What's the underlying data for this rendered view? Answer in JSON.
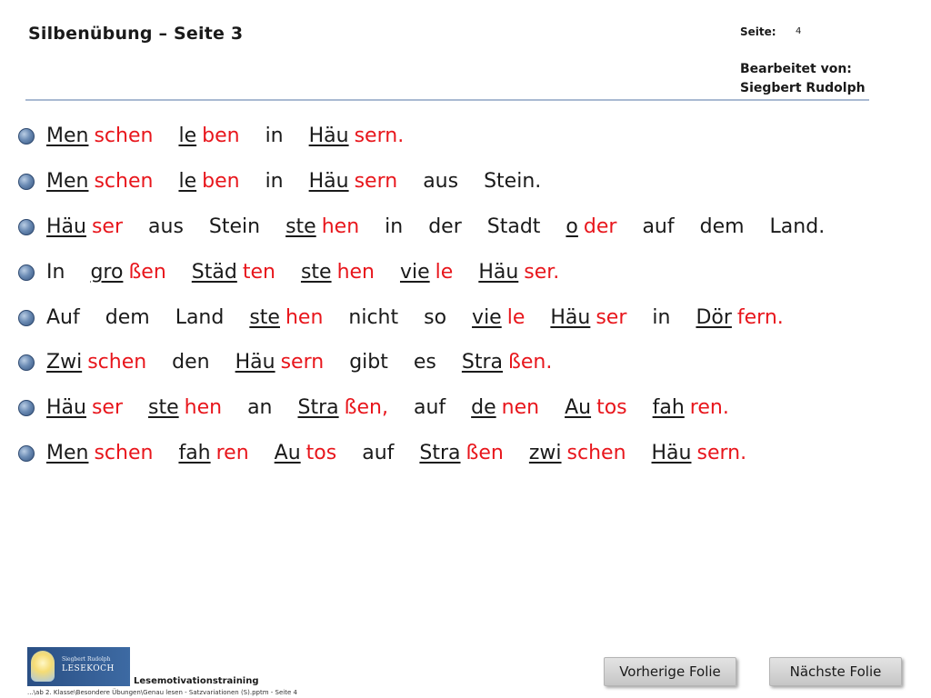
{
  "header": {
    "title": "Silbenübung – Seite 3",
    "page_label": "Seite:",
    "page_number": "4",
    "editor_label": "Bearbeitet von:",
    "editor_name": "Siegbert Rudolph"
  },
  "colors": {
    "accent_red": "#e8161c",
    "text": "#1a1a1a",
    "rule": "#a9bad2",
    "bullet": "#4a6a96"
  },
  "sentences": [
    {
      "words": [
        [
          {
            "t": "Men",
            "c": "black",
            "u": true
          },
          {
            "t": "schen",
            "c": "red",
            "u": false
          }
        ],
        [
          {
            "t": "le",
            "c": "black",
            "u": true
          },
          {
            "t": "ben",
            "c": "red",
            "u": false
          }
        ],
        [
          {
            "t": "in",
            "c": "black",
            "u": false
          }
        ],
        [
          {
            "t": "Häu",
            "c": "black",
            "u": true
          },
          {
            "t": "sern.",
            "c": "red",
            "u": false
          }
        ]
      ]
    },
    {
      "words": [
        [
          {
            "t": "Men",
            "c": "black",
            "u": true
          },
          {
            "t": "schen",
            "c": "red",
            "u": false
          }
        ],
        [
          {
            "t": "le",
            "c": "black",
            "u": true
          },
          {
            "t": "ben",
            "c": "red",
            "u": false
          }
        ],
        [
          {
            "t": "in",
            "c": "black",
            "u": false
          }
        ],
        [
          {
            "t": "Häu",
            "c": "black",
            "u": true
          },
          {
            "t": "sern",
            "c": "red",
            "u": false
          }
        ],
        [
          {
            "t": "aus",
            "c": "black",
            "u": false
          }
        ],
        [
          {
            "t": "Stein.",
            "c": "black",
            "u": false
          }
        ]
      ]
    },
    {
      "words": [
        [
          {
            "t": "Häu",
            "c": "black",
            "u": true
          },
          {
            "t": "ser",
            "c": "red",
            "u": false
          }
        ],
        [
          {
            "t": "aus",
            "c": "black",
            "u": false
          }
        ],
        [
          {
            "t": "Stein",
            "c": "black",
            "u": false
          }
        ],
        [
          {
            "t": "ste",
            "c": "black",
            "u": true
          },
          {
            "t": "hen",
            "c": "red",
            "u": false
          }
        ],
        [
          {
            "t": "in",
            "c": "black",
            "u": false
          }
        ],
        [
          {
            "t": "der",
            "c": "black",
            "u": false
          }
        ],
        [
          {
            "t": "Stadt",
            "c": "black",
            "u": false
          }
        ],
        [
          {
            "t": "o",
            "c": "black",
            "u": true
          },
          {
            "t": "der",
            "c": "red",
            "u": false
          }
        ],
        [
          {
            "t": "auf",
            "c": "black",
            "u": false
          }
        ],
        [
          {
            "t": "dem",
            "c": "black",
            "u": false
          }
        ],
        [
          {
            "t": "Land.",
            "c": "black",
            "u": false
          }
        ]
      ]
    },
    {
      "words": [
        [
          {
            "t": "In",
            "c": "black",
            "u": false
          }
        ],
        [
          {
            "t": "gro",
            "c": "black",
            "u": true
          },
          {
            "t": "ßen",
            "c": "red",
            "u": false
          }
        ],
        [
          {
            "t": "Städ",
            "c": "black",
            "u": true
          },
          {
            "t": "ten",
            "c": "red",
            "u": false
          }
        ],
        [
          {
            "t": "ste",
            "c": "black",
            "u": true
          },
          {
            "t": "hen",
            "c": "red",
            "u": false
          }
        ],
        [
          {
            "t": "vie",
            "c": "black",
            "u": true
          },
          {
            "t": "le",
            "c": "red",
            "u": false
          }
        ],
        [
          {
            "t": "Häu",
            "c": "black",
            "u": true
          },
          {
            "t": "ser.",
            "c": "red",
            "u": false
          }
        ]
      ]
    },
    {
      "words": [
        [
          {
            "t": "Auf",
            "c": "black",
            "u": false
          }
        ],
        [
          {
            "t": "dem",
            "c": "black",
            "u": false
          }
        ],
        [
          {
            "t": "Land",
            "c": "black",
            "u": false
          }
        ],
        [
          {
            "t": "ste",
            "c": "black",
            "u": true
          },
          {
            "t": "hen",
            "c": "red",
            "u": false
          }
        ],
        [
          {
            "t": "nicht",
            "c": "black",
            "u": false
          }
        ],
        [
          {
            "t": "so",
            "c": "black",
            "u": false
          }
        ],
        [
          {
            "t": "vie",
            "c": "black",
            "u": true
          },
          {
            "t": "le",
            "c": "red",
            "u": false
          }
        ],
        [
          {
            "t": "Häu",
            "c": "black",
            "u": true
          },
          {
            "t": "ser",
            "c": "red",
            "u": false
          }
        ],
        [
          {
            "t": "in",
            "c": "black",
            "u": false
          }
        ],
        [
          {
            "t": "Dör",
            "c": "black",
            "u": true
          },
          {
            "t": "fern.",
            "c": "red",
            "u": false
          }
        ]
      ]
    },
    {
      "words": [
        [
          {
            "t": "Zwi",
            "c": "black",
            "u": true
          },
          {
            "t": "schen",
            "c": "red",
            "u": false
          }
        ],
        [
          {
            "t": "den",
            "c": "black",
            "u": false
          }
        ],
        [
          {
            "t": "Häu",
            "c": "black",
            "u": true
          },
          {
            "t": "sern",
            "c": "red",
            "u": false
          }
        ],
        [
          {
            "t": "gibt",
            "c": "black",
            "u": false
          }
        ],
        [
          {
            "t": "es",
            "c": "black",
            "u": false
          }
        ],
        [
          {
            "t": "Stra",
            "c": "black",
            "u": true
          },
          {
            "t": "ßen.",
            "c": "red",
            "u": false
          }
        ]
      ]
    },
    {
      "words": [
        [
          {
            "t": "Häu",
            "c": "black",
            "u": true
          },
          {
            "t": "ser",
            "c": "red",
            "u": false
          }
        ],
        [
          {
            "t": "ste",
            "c": "black",
            "u": true
          },
          {
            "t": "hen",
            "c": "red",
            "u": false
          }
        ],
        [
          {
            "t": "an",
            "c": "black",
            "u": false
          }
        ],
        [
          {
            "t": "Stra",
            "c": "black",
            "u": true
          },
          {
            "t": "ßen,",
            "c": "red",
            "u": false
          }
        ],
        [
          {
            "t": "auf",
            "c": "black",
            "u": false
          }
        ],
        [
          {
            "t": "de",
            "c": "black",
            "u": true
          },
          {
            "t": "nen",
            "c": "red",
            "u": false
          }
        ],
        [
          {
            "t": "Au",
            "c": "black",
            "u": true
          },
          {
            "t": "tos",
            "c": "red",
            "u": false
          }
        ],
        [
          {
            "t": "fah",
            "c": "black",
            "u": true
          },
          {
            "t": "ren.",
            "c": "red",
            "u": false
          }
        ]
      ]
    },
    {
      "words": [
        [
          {
            "t": "Men",
            "c": "black",
            "u": true
          },
          {
            "t": "schen",
            "c": "red",
            "u": false
          }
        ],
        [
          {
            "t": "fah",
            "c": "black",
            "u": true
          },
          {
            "t": "ren",
            "c": "red",
            "u": false
          }
        ],
        [
          {
            "t": "Au",
            "c": "black",
            "u": true
          },
          {
            "t": "tos",
            "c": "red",
            "u": false
          }
        ],
        [
          {
            "t": "auf",
            "c": "black",
            "u": false
          }
        ],
        [
          {
            "t": "Stra",
            "c": "black",
            "u": true
          },
          {
            "t": "ßen",
            "c": "red",
            "u": false
          }
        ],
        [
          {
            "t": "zwi",
            "c": "black",
            "u": true
          },
          {
            "t": "schen",
            "c": "red",
            "u": false
          }
        ],
        [
          {
            "t": "Häu",
            "c": "black",
            "u": true
          },
          {
            "t": "sern.",
            "c": "red",
            "u": false
          }
        ]
      ]
    }
  ],
  "footer": {
    "logo_small_text": "Siegbert Rudolph",
    "logo_big_text": "LESEKOCH",
    "title": "Lesemotivationstraining",
    "path": "...\\ab 2. Klasse\\Besondere Übungen\\Genau lesen - Satzvariationen (S).pptm - Seite 4"
  },
  "nav": {
    "prev_label": "Vorherige Folie",
    "next_label": "Nächste Folie"
  }
}
